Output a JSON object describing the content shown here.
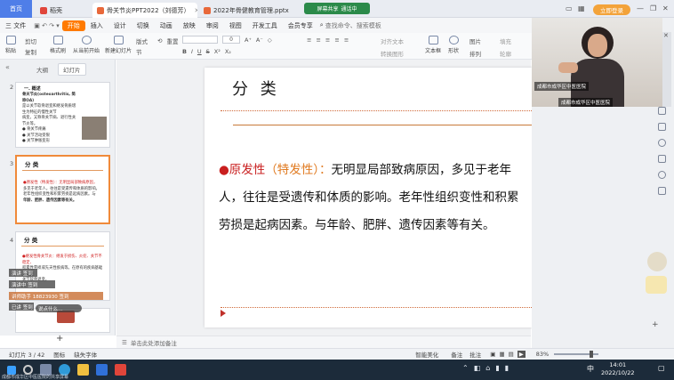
{
  "tabs": [
    {
      "label": "首页"
    },
    {
      "label": "稻壳"
    },
    {
      "label": "骨关节炎PPT2022（刘德芳）"
    },
    {
      "label": "2022年骨健教育管理.pptx"
    }
  ],
  "meeting": {
    "status": "通话中",
    "screen": "屏幕共享"
  },
  "login_label": "立即登录",
  "menu": {
    "file": "三 文件",
    "items": [
      "开始",
      "插入",
      "设计",
      "切换",
      "动画",
      "放映",
      "审阅",
      "视图",
      "开发工具",
      "会员专享"
    ],
    "search_placeholder": "查找命令、搜索模板"
  },
  "ribbon": {
    "paste": "粘贴",
    "cut": "剪切",
    "copy": "复制",
    "format_painter": "格式刷",
    "from_start": "从当前开始",
    "new_slide": "新建幻灯片",
    "layout": "版式",
    "section": "节",
    "reset": "重置",
    "font_size": "0",
    "font_controls": [
      "A⁺",
      "A⁻",
      "◇"
    ],
    "format_controls": [
      "B",
      "I",
      "U",
      "S",
      "X²",
      "X₂"
    ],
    "para_controls": [
      "≡",
      "≡",
      "≡",
      "≡",
      "≡"
    ],
    "textbox": "文本框",
    "shape": "形状",
    "arrange": "排列",
    "picture": "图片",
    "fill": "填充",
    "outline": "轮廓",
    "align_text": "对齐文本",
    "convert_smartart": "转换图形"
  },
  "panel_tabs": {
    "outline": "大纲",
    "slides": "幻灯片"
  },
  "thumbnails": [
    {
      "num": "2",
      "title": "一. 概述",
      "lines": [
        "骨关节炎(osteoarthritis, 简称OA)",
        "是以关节软骨退变和继发骨质增生为特征的慢性关节",
        "病变，又称骨关节病、退行性关节炎等。",
        "● 骨关节疼痛",
        "● 关节活动受限",
        "● 关节肿胀变形"
      ]
    },
    {
      "num": "3",
      "title": "分 类",
      "lines": [
        "●原发性（特发性）：无明显局部致病原因，",
        "多见于老年人，往往是受遗传和体质的影响。",
        "老年性组织变性和积累劳损是起病因素。与",
        "年龄、肥胖、遗传因素等有关。"
      ]
    },
    {
      "num": "4",
      "title": "分 类",
      "lines": [
        "●继发性骨关节炎：继发于损伤、炎症、关节不稳定、",
        "积累性劳损或先天性疾病等。在原有的疾病基础上发生",
        "关节软骨退变。"
      ]
    }
  ],
  "overlays": [
    "演讲 签到",
    "演讲中 签到",
    "讲师助手 18823930 签到",
    "已讲 签到",
    "说点什么..."
  ],
  "slide": {
    "title": "分  类",
    "lead": "●原发性",
    "paren": "（特发性）：",
    "body_first": "无明显局部致病原因，",
    "body_rest": "多见于老年人，往往是受遗传和体质的影响。老年性组织变性和积累劳损是起病因素。与年龄、肥胖、遗传因素等有关。"
  },
  "notes_placeholder": "单击此处添加备注",
  "camera": {
    "top_label": "成都市成华区中医医院",
    "bottom_label": "成都市成华区中医医院"
  },
  "statusbar": {
    "slide_counter": "幻灯片 3 / 42",
    "theme": "图标",
    "font_missing": "缺失字体",
    "smart_beautify": "智能美化",
    "notes": "备注",
    "comments": "批注",
    "zoom": "83%"
  },
  "taskbar": {
    "time": "14:01",
    "date": "2022/10/22",
    "ime": "中",
    "caption": "成都市成华区中医医院的共享屏幕"
  },
  "colors": {
    "accent_orange": "#ff7a00",
    "slide_red": "#c91f1f",
    "slide_title_line": "#c87a3a",
    "home_tab": "#4f7ee8"
  }
}
